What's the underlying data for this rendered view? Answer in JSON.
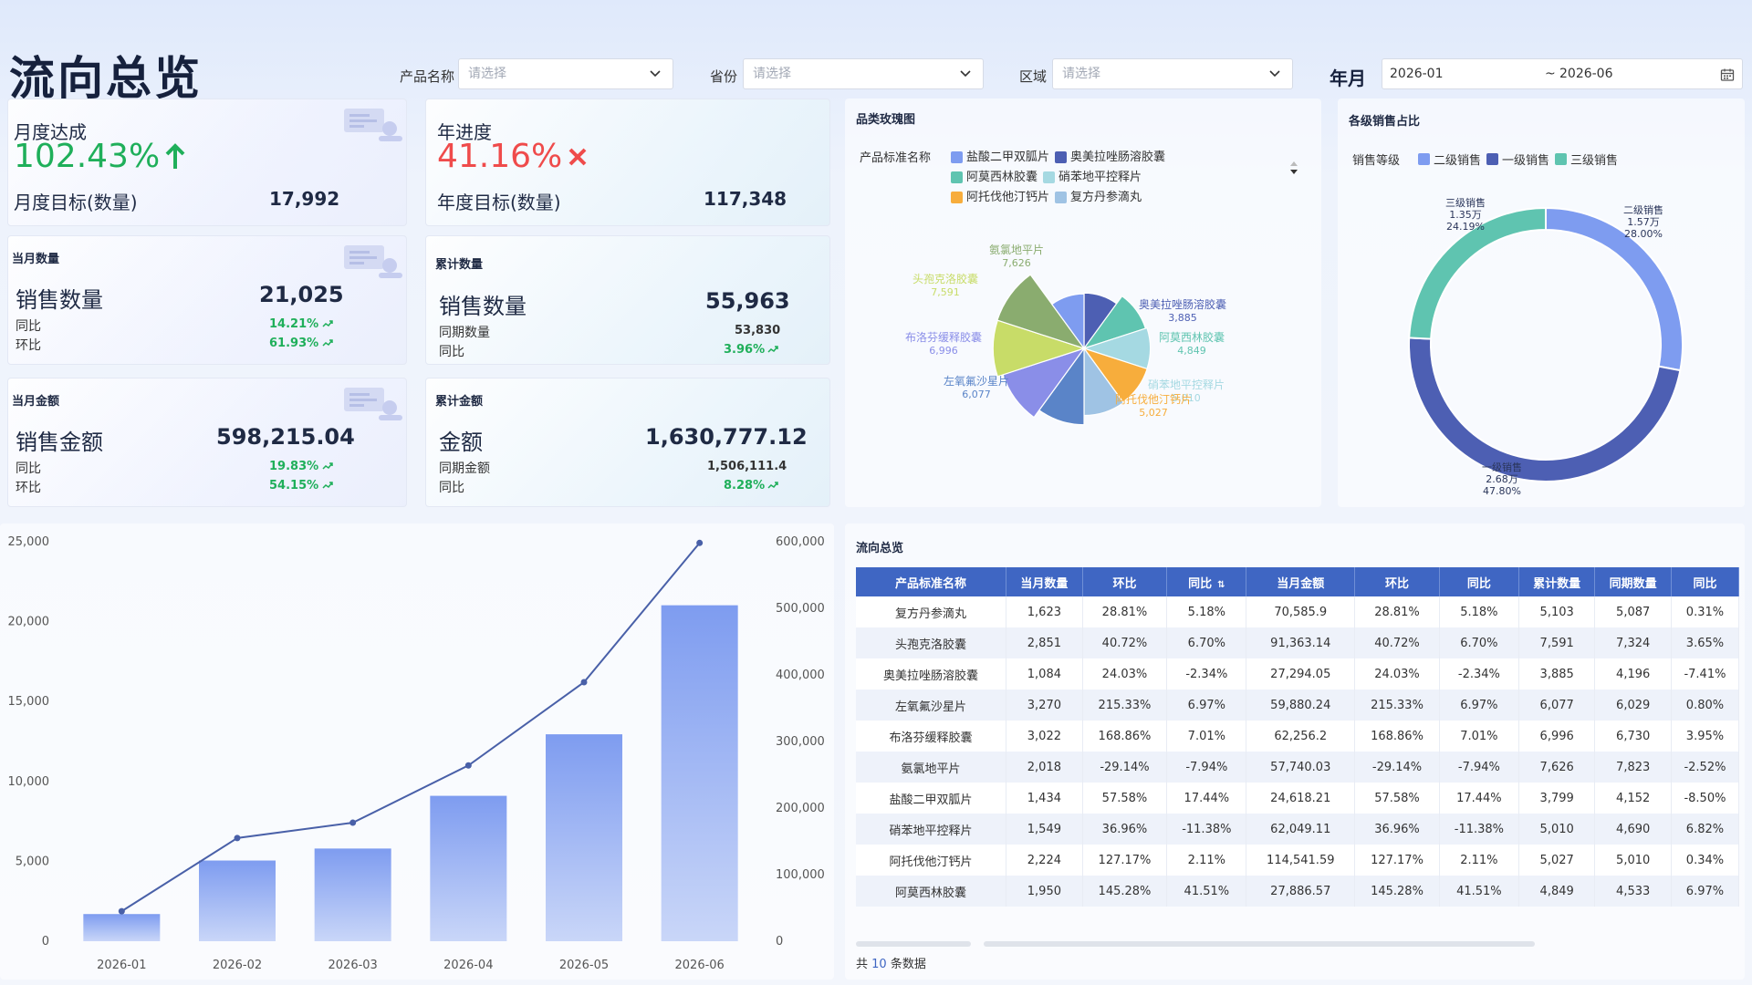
{
  "page_title": "流向总览",
  "filters": {
    "product": {
      "label": "产品名称",
      "placeholder": "请选择"
    },
    "province": {
      "label": "省份",
      "placeholder": "请选择"
    },
    "region": {
      "label": "区域",
      "placeholder": "请选择"
    },
    "yearmonth": {
      "label": "年月",
      "start": "2026-01",
      "sep": "~",
      "end": "2026-06"
    }
  },
  "kpi": {
    "monthly": {
      "title": "月度达成",
      "pct": "102.43%",
      "target_label": "月度目标(数量)",
      "target_value": "17,992"
    },
    "yearly": {
      "title": "年进度",
      "pct": "41.16%",
      "target_label": "年度目标(数量)",
      "target_value": "117,348"
    },
    "month_qty": {
      "section": "当月数量",
      "name": "销售数量",
      "value": "21,025",
      "r1_label": "同比",
      "r1_value": "14.21%",
      "r2_label": "环比",
      "r2_value": "61.93%"
    },
    "cum_qty": {
      "section": "累计数量",
      "name": "销售数量",
      "value": "55,963",
      "r1_label": "同期数量",
      "r1_value": "53,830",
      "r2_label": "同比",
      "r2_value": "3.96%"
    },
    "month_amt": {
      "section": "当月金额",
      "name": "销售金额",
      "value": "598,215.04",
      "r1_label": "同比",
      "r1_value": "19.83%",
      "r2_label": "环比",
      "r2_value": "54.15%"
    },
    "cum_amt": {
      "section": "累计金额",
      "name": "金额",
      "value": "1,630,777.12",
      "r1_label": "同期金额",
      "r1_value": "1,506,111.4",
      "r2_label": "同比",
      "r2_value": "8.28%"
    }
  },
  "rose": {
    "title": "品类玫瑰图",
    "legend_title": "产品标准名称",
    "legend": [
      {
        "name": "盐酸二甲双胍片",
        "color": "#7e9cf0"
      },
      {
        "name": "奥美拉唑肠溶胶囊",
        "color": "#4d5fb3"
      },
      {
        "name": "阿莫西林胶囊",
        "color": "#5fc4b0"
      },
      {
        "name": "硝苯地平控释片",
        "color": "#a5d9e2"
      },
      {
        "name": "阿托伐他汀钙片",
        "color": "#f7ad3c"
      },
      {
        "name": "复方丹参滴丸",
        "color": "#9fc3e4"
      }
    ]
  },
  "donut": {
    "title": "各级销售占比",
    "legend_title": "销售等级",
    "legend": [
      {
        "name": "二级销售",
        "color": "#7e9cf0"
      },
      {
        "name": "一级销售",
        "color": "#4d5fb3"
      },
      {
        "name": "三级销售",
        "color": "#5fc4b0"
      }
    ]
  },
  "table": {
    "title": "流向总览",
    "headers": [
      "产品标准名称",
      "当月数量",
      "环比",
      "同比",
      "当月金额",
      "环比",
      "同比",
      "累计数量",
      "同期数量",
      "同比"
    ],
    "rows": [
      [
        "复方丹参滴丸",
        "1,623",
        "28.81%",
        "5.18%",
        "70,585.9",
        "28.81%",
        "5.18%",
        "5,103",
        "5,087",
        "0.31%"
      ],
      [
        "头孢克洛胶囊",
        "2,851",
        "40.72%",
        "6.70%",
        "91,363.14",
        "40.72%",
        "6.70%",
        "7,591",
        "7,324",
        "3.65%"
      ],
      [
        "奥美拉唑肠溶胶囊",
        "1,084",
        "24.03%",
        "-2.34%",
        "27,294.05",
        "24.03%",
        "-2.34%",
        "3,885",
        "4,196",
        "-7.41%"
      ],
      [
        "左氧氟沙星片",
        "3,270",
        "215.33%",
        "6.97%",
        "59,880.24",
        "215.33%",
        "6.97%",
        "6,077",
        "6,029",
        "0.80%"
      ],
      [
        "布洛芬缓释胶囊",
        "3,022",
        "168.86%",
        "7.01%",
        "62,256.2",
        "168.86%",
        "7.01%",
        "6,996",
        "6,730",
        "3.95%"
      ],
      [
        "氨氯地平片",
        "2,018",
        "-29.14%",
        "-7.94%",
        "57,740.03",
        "-29.14%",
        "-7.94%",
        "7,626",
        "7,823",
        "-2.52%"
      ],
      [
        "盐酸二甲双胍片",
        "1,434",
        "57.58%",
        "17.44%",
        "24,618.21",
        "57.58%",
        "17.44%",
        "3,799",
        "4,152",
        "-8.50%"
      ],
      [
        "硝苯地平控释片",
        "1,549",
        "36.96%",
        "-11.38%",
        "62,049.11",
        "36.96%",
        "-11.38%",
        "5,010",
        "4,690",
        "6.82%"
      ],
      [
        "阿托伐他汀钙片",
        "2,224",
        "127.17%",
        "2.11%",
        "114,541.59",
        "127.17%",
        "2.11%",
        "5,027",
        "5,010",
        "0.34%"
      ],
      [
        "阿莫西林胶囊",
        "1,950",
        "145.28%",
        "41.51%",
        "27,886.57",
        "145.28%",
        "41.51%",
        "4,849",
        "4,533",
        "6.97%"
      ]
    ],
    "footer_prefix": "共",
    "footer_count": "10",
    "footer_suffix": "条数据"
  },
  "chart_data": [
    {
      "type": "bar",
      "categories": [
        "2026-01",
        "2026-02",
        "2026-03",
        "2026-04",
        "2026-05",
        "2026-06"
      ],
      "series": [
        {
          "type": "bar",
          "axis": "left",
          "values": [
            1700,
            5050,
            5800,
            9100,
            12950,
            21025
          ]
        },
        {
          "type": "line",
          "axis": "right",
          "values": [
            45000,
            155000,
            178000,
            264000,
            389000,
            598215
          ]
        }
      ],
      "ylim_left": [
        0,
        25000
      ],
      "ylim_right": [
        0,
        600000
      ],
      "yticks_left": [
        "0",
        "5,000",
        "10,000",
        "15,000",
        "20,000",
        "25,000"
      ],
      "yticks_right": [
        "0",
        "100,000",
        "200,000",
        "300,000",
        "400,000",
        "500,000",
        "600,000"
      ]
    },
    {
      "type": "pie",
      "variant": "rose",
      "slices": [
        {
          "name": "奥美拉唑肠溶胶囊",
          "value": 3885,
          "color": "#4d5fb3"
        },
        {
          "name": "阿莫西林胶囊",
          "value": 4849,
          "color": "#5fc4b0"
        },
        {
          "name": "硝苯地平控释片",
          "value": 5010,
          "color": "#a5d9e2"
        },
        {
          "name": "阿托伐他汀钙片",
          "value": 5027,
          "color": "#f7ad3c"
        },
        {
          "name": "复方丹参滴丸",
          "value": 5103,
          "color": "#9fc3e4"
        },
        {
          "name": "左氧氟沙星片",
          "value": 6077,
          "color": "#5a84c8"
        },
        {
          "name": "布洛芬缓释胶囊",
          "value": 6996,
          "color": "#8a8ee8"
        },
        {
          "name": "头孢克洛胶囊",
          "value": 7591,
          "color": "#c8dc68"
        },
        {
          "name": "氨氯地平片",
          "value": 7626,
          "color": "#8aac6f"
        },
        {
          "name": "盐酸二甲双胍片",
          "value": 3799,
          "color": "#7e9cf0"
        }
      ],
      "labels": [
        {
          "name": "氨氯地平片",
          "value": "7,626"
        },
        {
          "name": "头孢克洛胶囊",
          "value": "7,591"
        },
        {
          "name": "奥美拉唑肠溶胶囊",
          "value": "3,885"
        },
        {
          "name": "布洛芬缓释胶囊",
          "value": "6,996"
        },
        {
          "name": "阿莫西林胶囊",
          "value": "4,849"
        },
        {
          "name": "硝苯地平控释片",
          "value": "5,010"
        },
        {
          "name": "左氧氟沙星片",
          "value": "6,077"
        },
        {
          "name": "阿托伐他汀钙片",
          "value": "5,027"
        }
      ]
    },
    {
      "type": "pie",
      "variant": "donut",
      "slices": [
        {
          "name": "二级销售",
          "value": 28.0,
          "display": "1.57万",
          "pct": "28.00%",
          "color": "#7e9cf0"
        },
        {
          "name": "一级销售",
          "value": 47.8,
          "display": "2.68万",
          "pct": "47.80%",
          "color": "#4d5fb3"
        },
        {
          "name": "三级销售",
          "value": 24.19,
          "display": "1.35万",
          "pct": "24.19%",
          "color": "#5fc4b0"
        }
      ]
    }
  ]
}
